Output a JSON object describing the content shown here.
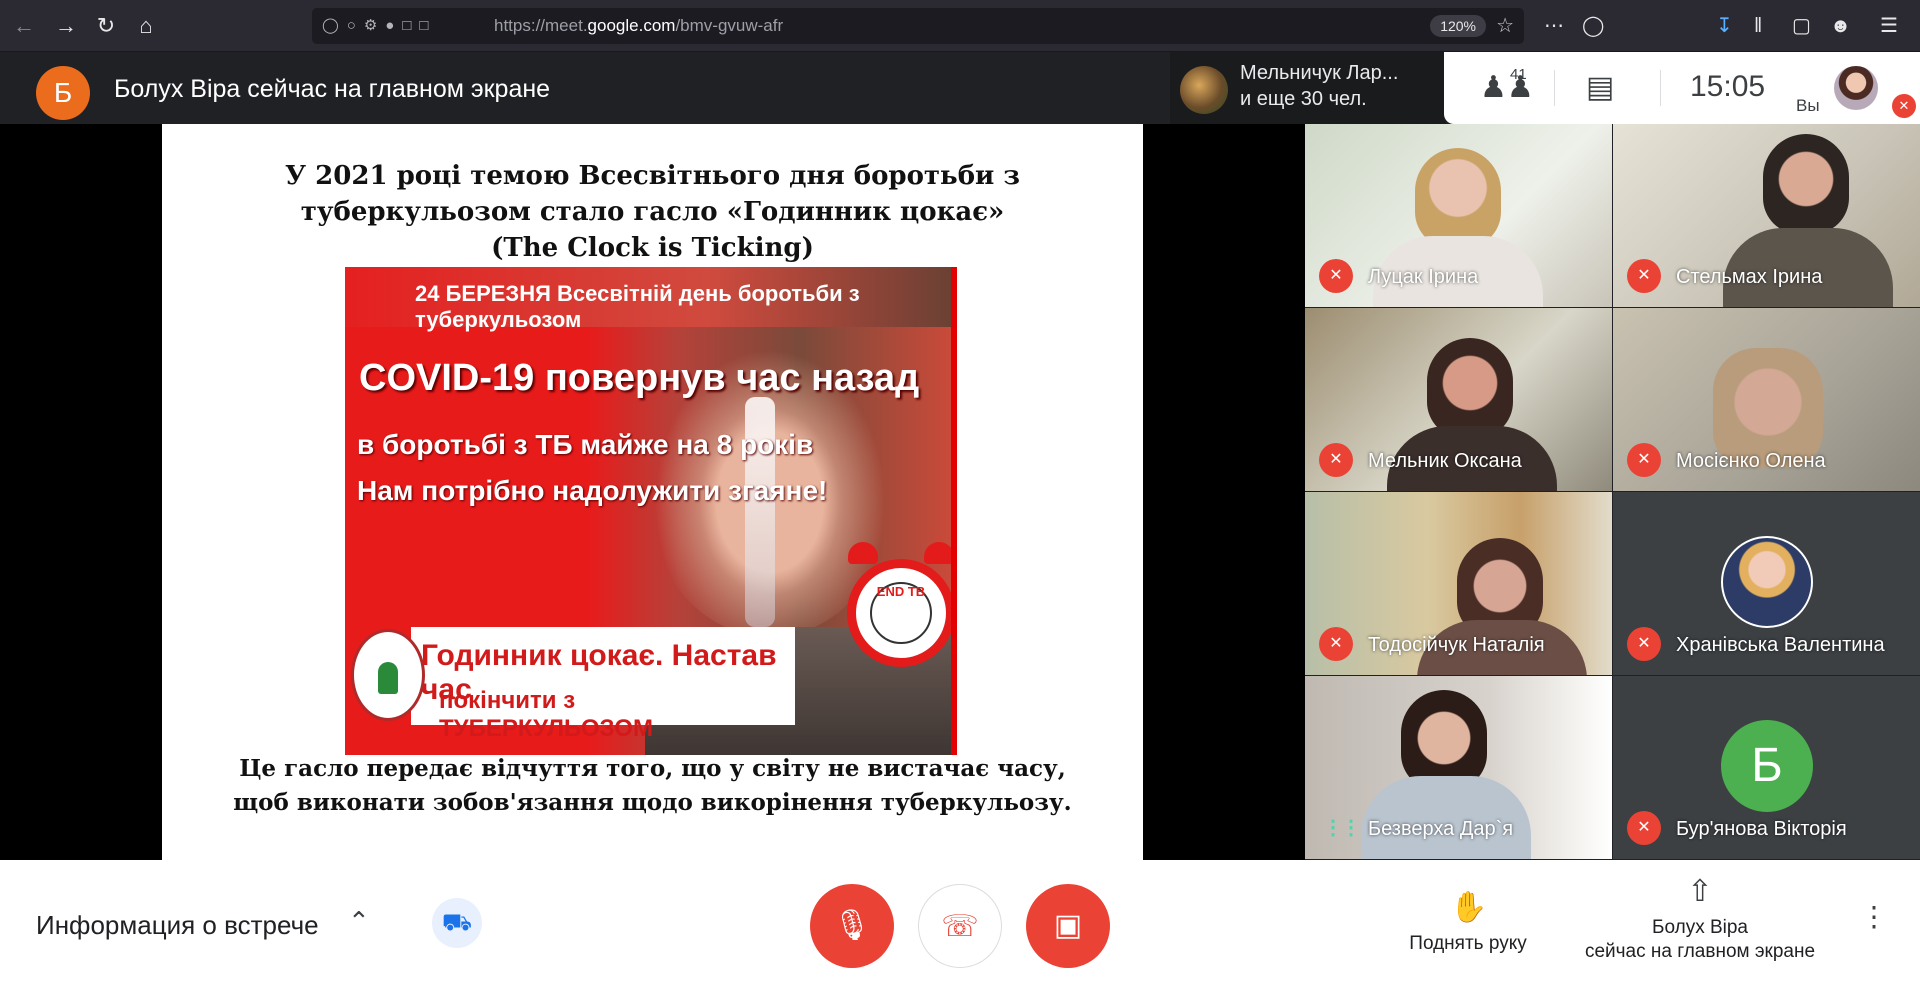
{
  "browser": {
    "url_prefix": "https://meet.",
    "url_domain": "google.com",
    "url_path": "/bmv-gvuw-afr",
    "zoom": "120%"
  },
  "header": {
    "presenter_initial": "Б",
    "presenter_title": "Болух Віра сейчас на главном экране",
    "others_line1": "Мельничук Лар...",
    "others_line2": "и еще 30 чел.",
    "people_count": "41",
    "time": "15:05",
    "you_label": "Вы"
  },
  "slide": {
    "heading": [
      "У 2021 році темою Всесвітнього дня боротьби з",
      "туберкульозом стало гасло «Годинник цокає»",
      "(The Clock is Ticking)"
    ],
    "poster": {
      "line1": "24 БЕРЕЗНЯ Всесвітній день боротьби з туберкульозом",
      "line2": "COVID-19 повернув час назад",
      "line3": "в боротьбі з ТБ майже на 8 років",
      "line4": "Нам потрібно надолужити згаяне!",
      "banner1": "Годинник цокає. Настав час",
      "banner2": "покінчити з ТУБЕРКУЛЬОЗОМ",
      "clock_text": "END TB"
    },
    "footer": [
      "Це гасло передає відчуття того, що у світу не вистачає часу,",
      "щоб виконати зобов'язання щодо викорінення туберкульозу."
    ]
  },
  "participants": [
    {
      "name": "Луцак Ірина",
      "state": "muted"
    },
    {
      "name": "Стельмах Ірина",
      "state": "muted"
    },
    {
      "name": "Мельник Оксана",
      "state": "muted"
    },
    {
      "name": "Мосієнко Олена",
      "state": "muted"
    },
    {
      "name": "Тодосійчук Наталія",
      "state": "muted"
    },
    {
      "name": "Хранівська Валентина",
      "state": "muted"
    },
    {
      "name": "Безверха Дар`я",
      "state": "speaking"
    },
    {
      "name": "Бур'янова Вікторія",
      "state": "muted",
      "initial": "Б"
    }
  ],
  "bottom": {
    "meeting_info": "Информация о встрече",
    "raise_hand": "Поднять руку",
    "presenting_line1": "Болух Віра",
    "presenting_line2": "сейчас на главном экране"
  },
  "colors": {
    "meet_dark": "#202124",
    "mute_red": "#ea4335",
    "presenter_orange": "#ea6c1c",
    "avatar_green": "#4caf50"
  }
}
